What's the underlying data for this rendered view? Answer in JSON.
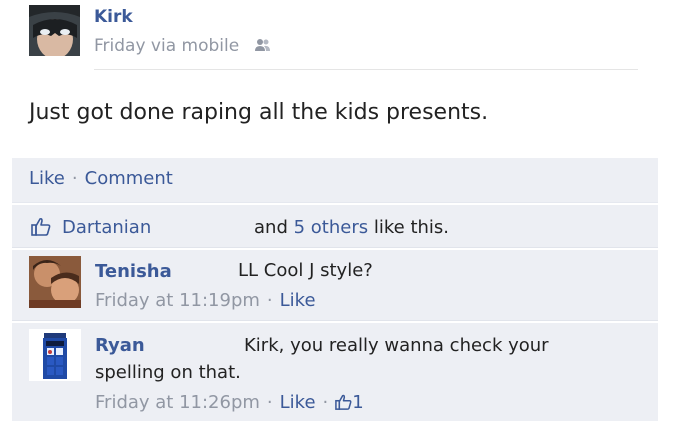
{
  "post": {
    "author": "Kirk",
    "meta": "Friday via mobile",
    "status": "Just got done raping all the kids presents."
  },
  "actions": {
    "like": "Like",
    "comment": "Comment"
  },
  "likes": {
    "first_name": "Dartanian",
    "and_text": "and",
    "others_link": "5 others",
    "suffix": "like this."
  },
  "comments": [
    {
      "name": "Tenisha",
      "text": "LL Cool J style?",
      "time": "Friday at 11:19pm",
      "like": "Like"
    },
    {
      "name": "Ryan",
      "text_line1": "Kirk, you really wanna check your",
      "text_line2": "spelling on that.",
      "time": "Friday at 11:26pm",
      "like": "Like",
      "like_count": "1"
    }
  ],
  "colors": {
    "link": "#3b5998",
    "muted": "#9197a3",
    "panel": "#edeff4"
  },
  "icons": {
    "audience": "people-icon",
    "like": "thumbs-up-icon"
  }
}
